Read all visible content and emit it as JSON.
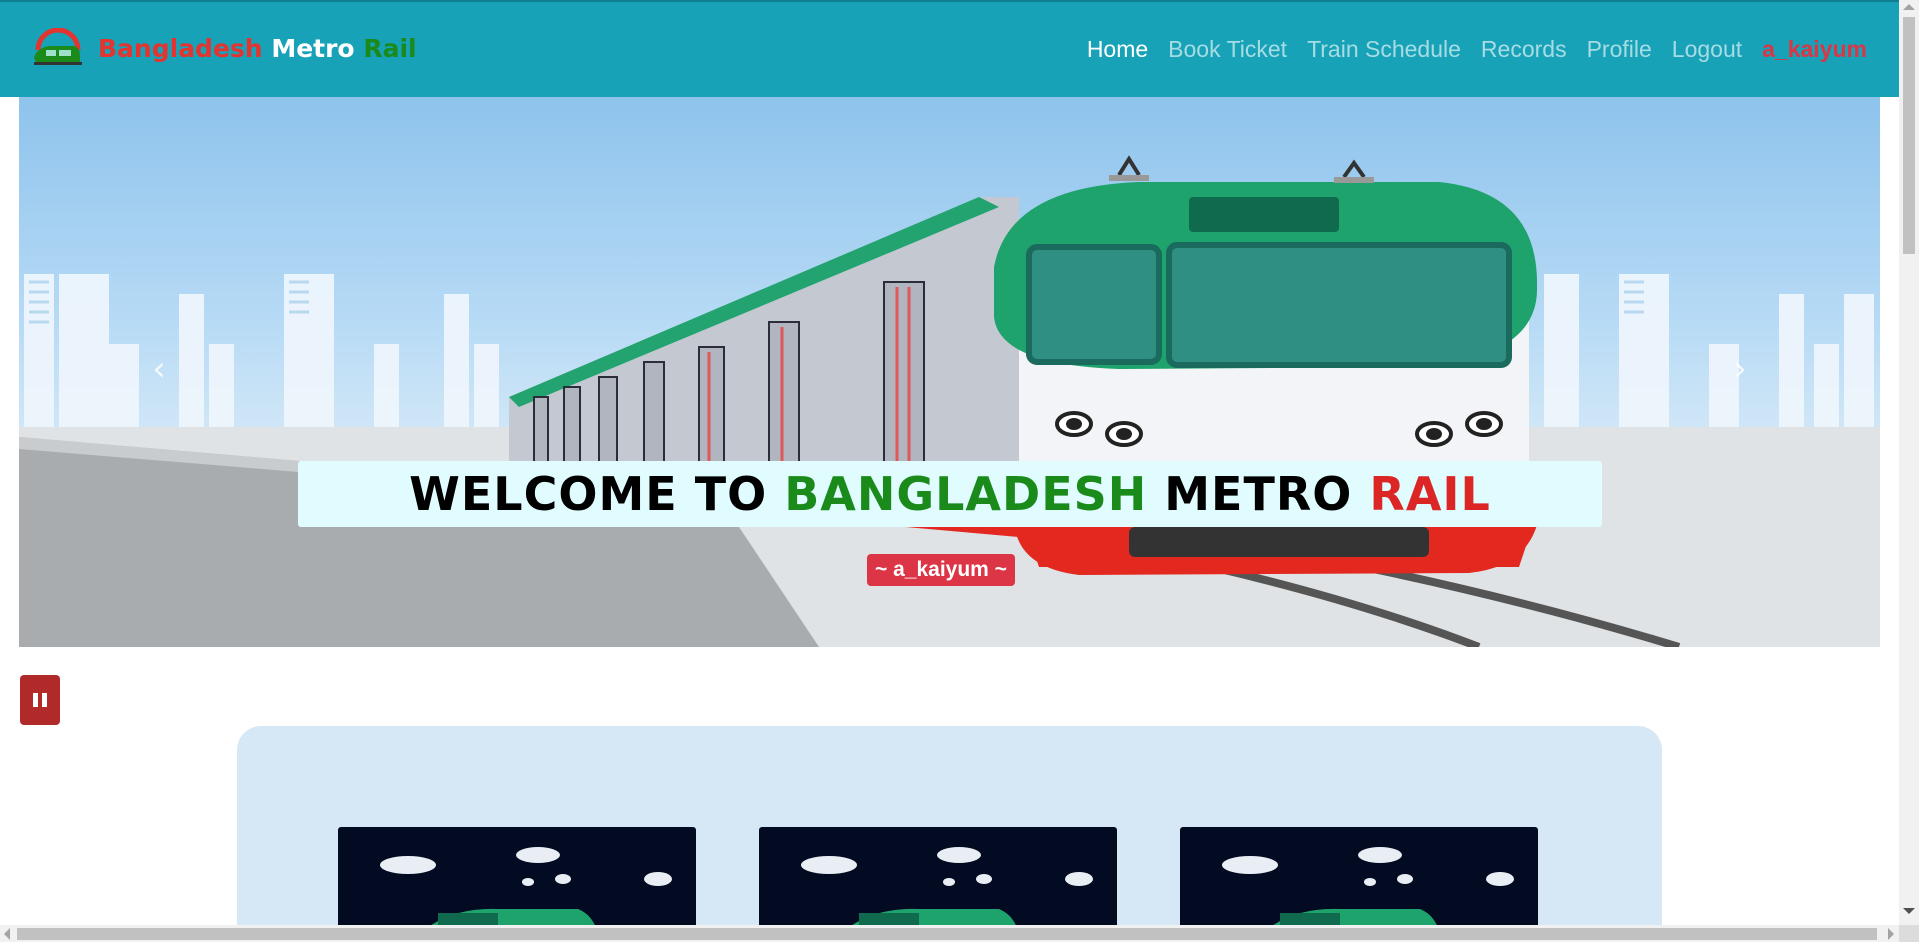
{
  "brand": {
    "word1": "Bangladesh",
    "word2": "Metro",
    "word3": "Rail",
    "logo_icon": "metro-train-logo"
  },
  "nav": {
    "items": [
      {
        "label": "Home",
        "active": true
      },
      {
        "label": "Book Ticket",
        "active": false
      },
      {
        "label": "Train Schedule",
        "active": false
      },
      {
        "label": "Records",
        "active": false
      },
      {
        "label": "Profile",
        "active": false
      },
      {
        "label": "Logout",
        "active": false
      }
    ],
    "username": "a_kaiyum"
  },
  "hero": {
    "caption_part1": "WELCOME TO ",
    "caption_part2": "BANGLADESH",
    "caption_part3": " METRO ",
    "caption_part4": "RAIL",
    "user_badge": "~ a_kaiyum ~",
    "prev_icon": "chevron-left-icon",
    "next_icon": "chevron-right-icon"
  },
  "controls": {
    "pause_icon": "pause-icon"
  },
  "cards": {
    "count": 3
  },
  "colors": {
    "navbar": "#17a2b8",
    "brand_red": "#e3342f",
    "brand_green": "#1a8a1a",
    "badge_red": "#dc3545",
    "train_green": "#1fa36c",
    "train_red": "#e3281f",
    "panel_bg": "#d6e8f6",
    "caption_bg": "#e0fcff"
  }
}
